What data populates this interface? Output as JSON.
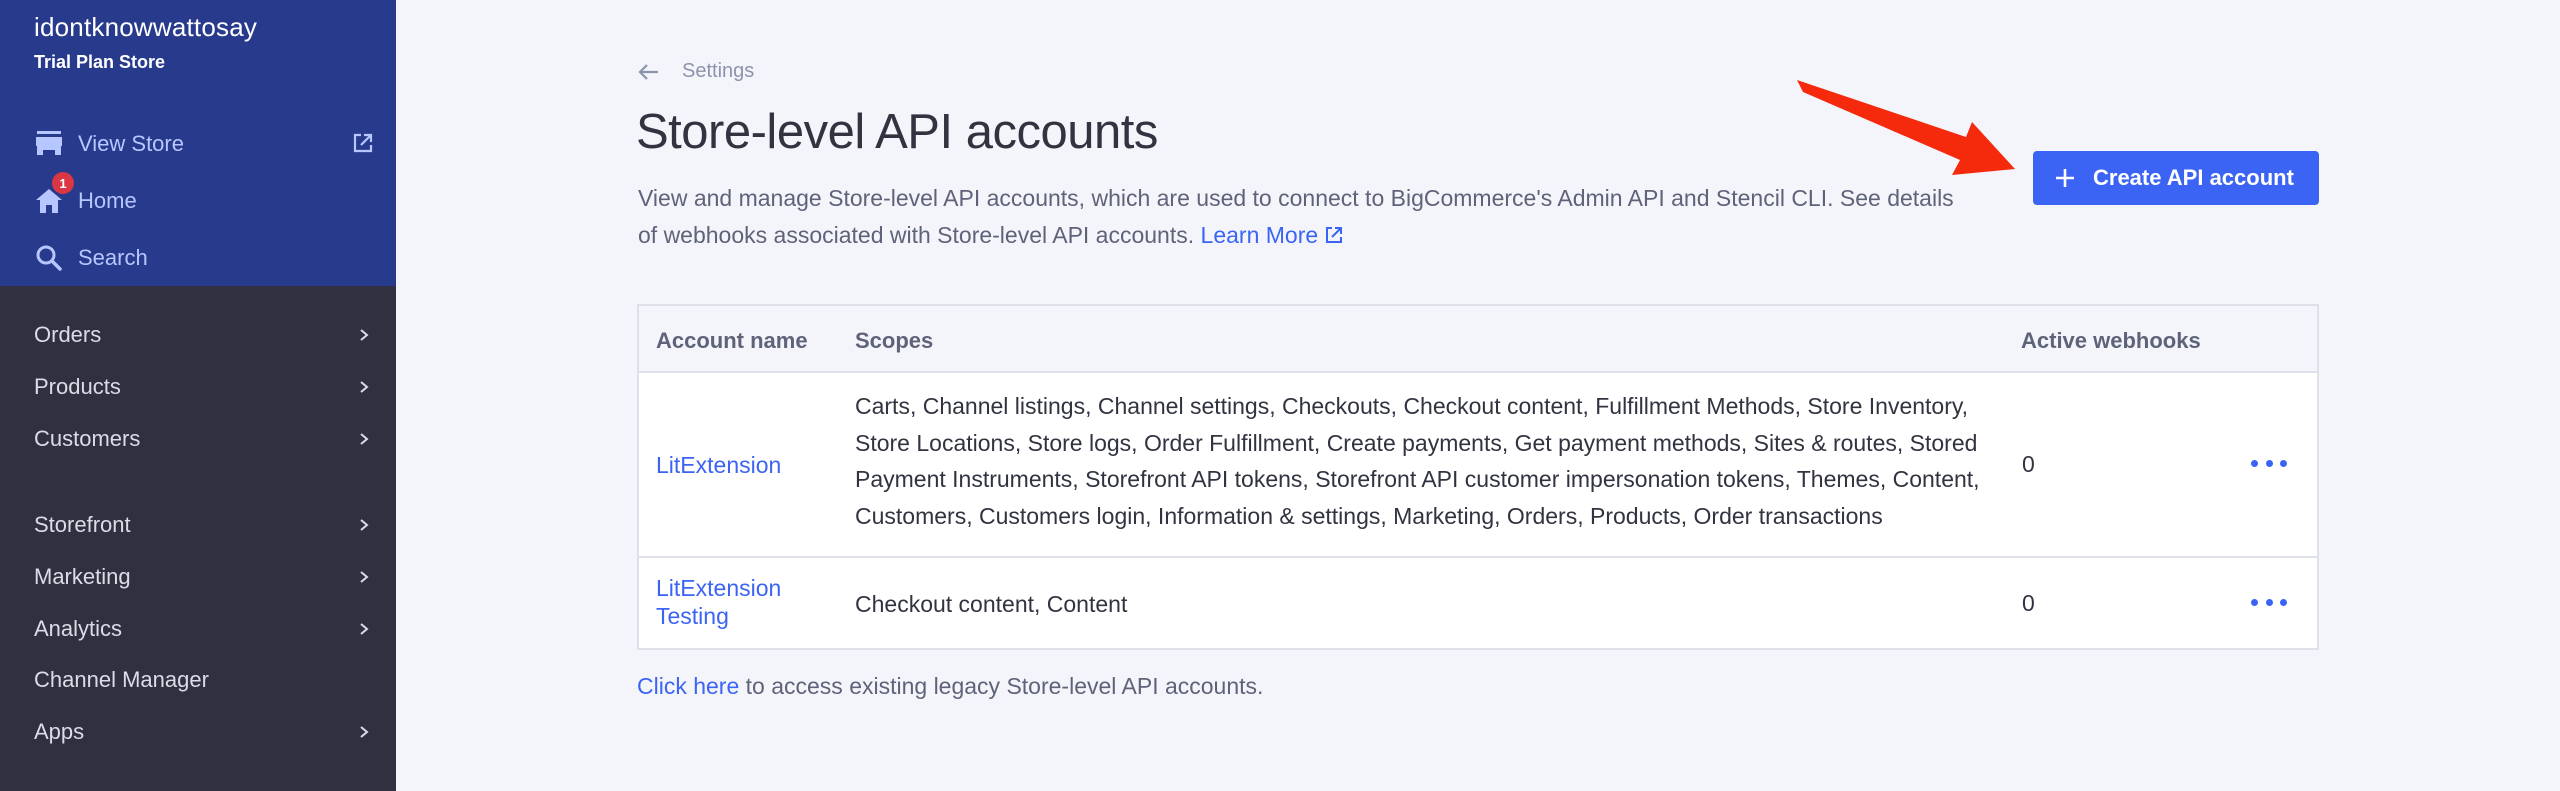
{
  "sidebar": {
    "store_name": "idontknowwattosay",
    "store_plan": "Trial Plan Store",
    "top_items": [
      {
        "label": "View Store",
        "icon": "storefront-icon",
        "external": true
      },
      {
        "label": "Home",
        "icon": "home-icon",
        "badge": "1"
      },
      {
        "label": "Search",
        "icon": "search-icon"
      }
    ],
    "nav_items": [
      {
        "label": "Orders",
        "has_children": true
      },
      {
        "label": "Products",
        "has_children": true
      },
      {
        "label": "Customers",
        "has_children": true
      },
      {
        "label": "Storefront",
        "has_children": true
      },
      {
        "label": "Marketing",
        "has_children": true
      },
      {
        "label": "Analytics",
        "has_children": true
      },
      {
        "label": "Channel Manager",
        "has_children": false
      },
      {
        "label": "Apps",
        "has_children": true
      }
    ]
  },
  "header": {
    "breadcrumb": "Settings",
    "title": "Store-level API accounts",
    "description": "View and manage Store-level API accounts, which are used to connect to BigCommerce's Admin API and Stencil CLI. See details of webhooks associated with Store-level API accounts.",
    "learn_more": "Learn More",
    "create_button": "Create API account"
  },
  "table": {
    "columns": [
      "Account name",
      "Scopes",
      "Active webhooks"
    ],
    "rows": [
      {
        "name": "LitExtension",
        "scopes": "Carts, Channel listings, Channel settings, Checkouts, Checkout content, Fulfillment Methods, Store Inventory, Store Locations, Store logs, Order Fulfillment, Create payments, Get payment methods, Sites & routes, Stored Payment Instruments, Storefront API tokens, Storefront API customer impersonation tokens, Themes, Content, Customers, Customers login, Information & settings, Marketing, Orders, Products, Order transactions",
        "active_webhooks": "0"
      },
      {
        "name": "LitExtension Testing",
        "scopes": "Checkout content, Content",
        "active_webhooks": "0"
      }
    ]
  },
  "footer": {
    "link": "Click here",
    "text": " to access existing legacy Store-level API accounts."
  },
  "colors": {
    "sidebar_top": "#283a8c",
    "sidebar_bottom": "#313040",
    "accent": "#3c64f4",
    "badge": "#db3643",
    "annotation_arrow": "#f52a0c"
  }
}
